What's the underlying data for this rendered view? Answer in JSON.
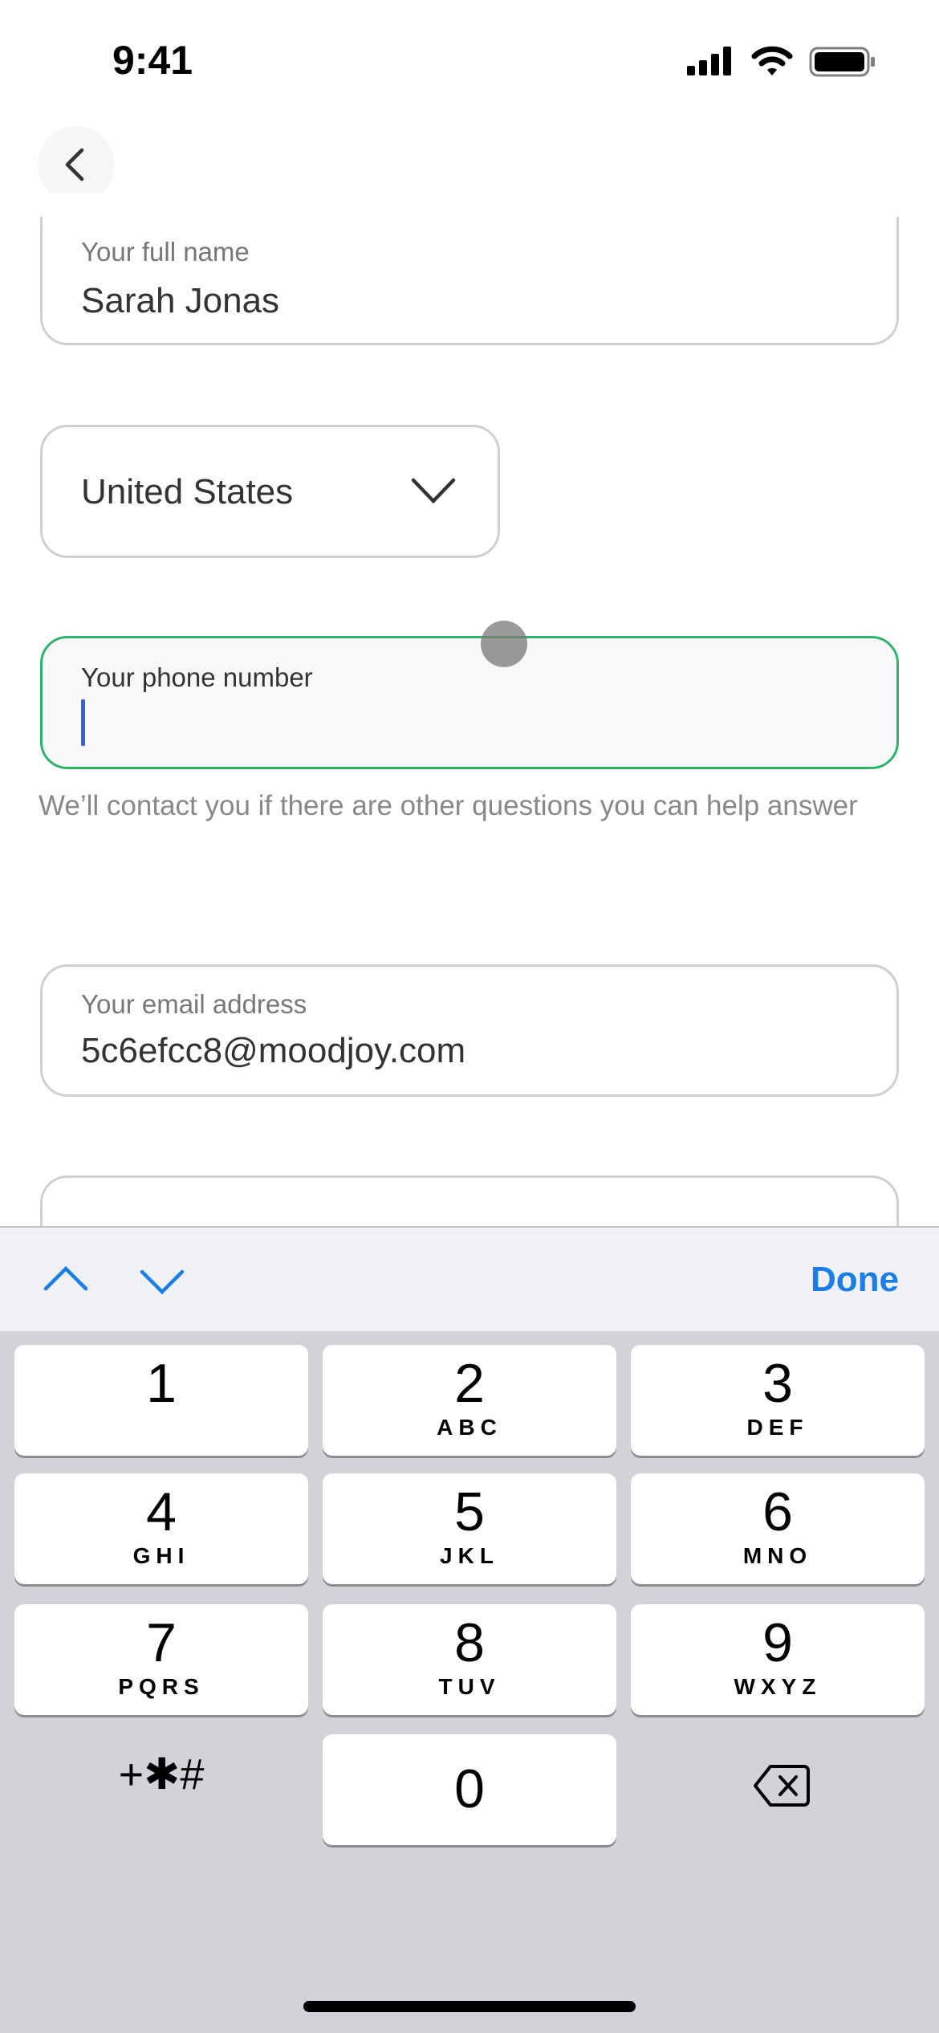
{
  "status": {
    "time": "9:41"
  },
  "form": {
    "name_label": "Your full name",
    "name_value": "Sarah Jonas",
    "country_value": "United States",
    "phone_label": "Your phone number",
    "phone_value": "",
    "phone_helper": "We’ll contact you if there are other questions you can help answer",
    "email_label": "Your email address",
    "email_value": "5c6efcc8@moodjoy.com"
  },
  "toolbar": {
    "done_label": "Done"
  },
  "colors": {
    "focus_border": "#2db36a",
    "accent": "#1a7ee6",
    "cursor": "#3b5bdb"
  },
  "keypad": {
    "keys": [
      {
        "digit": "1",
        "letters": ""
      },
      {
        "digit": "2",
        "letters": "ABC"
      },
      {
        "digit": "3",
        "letters": "DEF"
      },
      {
        "digit": "4",
        "letters": "GHI"
      },
      {
        "digit": "5",
        "letters": "JKL"
      },
      {
        "digit": "6",
        "letters": "MNO"
      },
      {
        "digit": "7",
        "letters": "PQRS"
      },
      {
        "digit": "8",
        "letters": "TUV"
      },
      {
        "digit": "9",
        "letters": "WXYZ"
      }
    ],
    "symbols": "+✱#",
    "zero": "0"
  }
}
